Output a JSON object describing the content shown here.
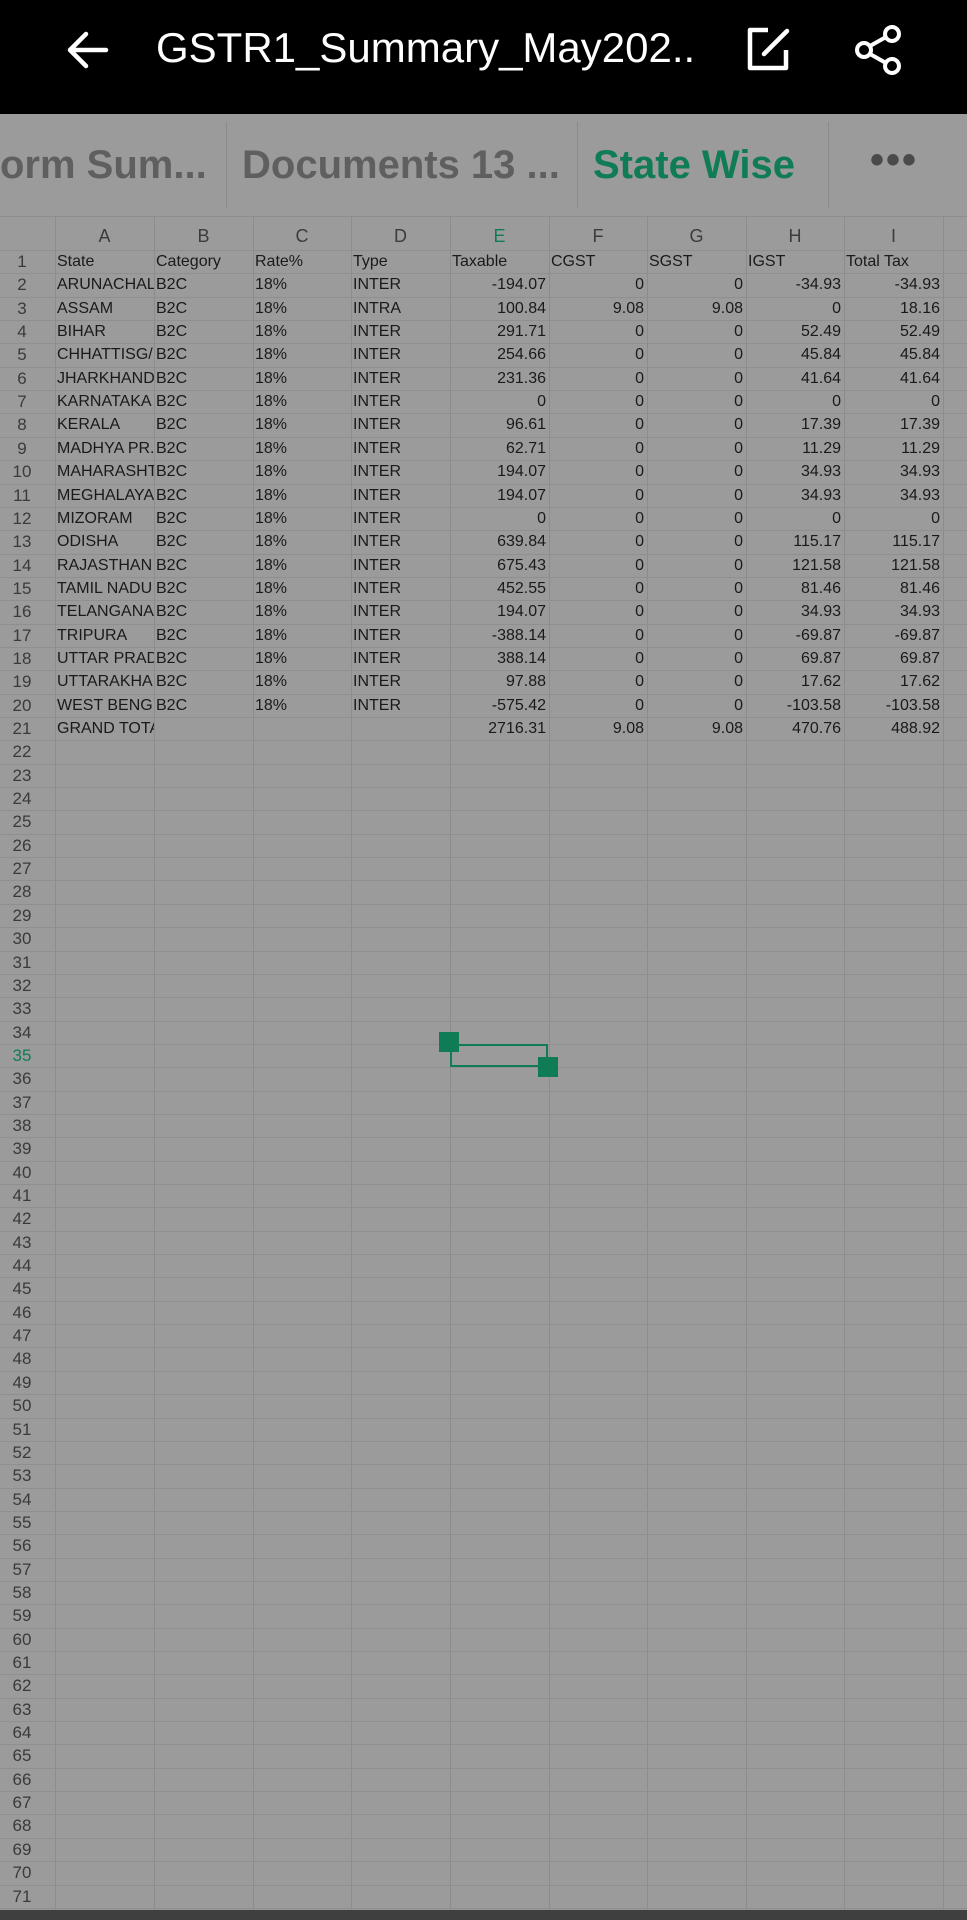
{
  "header": {
    "title": "GSTR1_Summary_May202...",
    "back_icon": "arrow-left-icon",
    "edit_icon": "edit-icon",
    "share_icon": "share-icon"
  },
  "tabs": [
    {
      "label": "orm Sum..."
    },
    {
      "label": "Documents 13 ..."
    },
    {
      "label": "State Wise",
      "active": true
    },
    {
      "label": "•••"
    }
  ],
  "sheet": {
    "columns": [
      "A",
      "B",
      "C",
      "D",
      "E",
      "F",
      "G",
      "H",
      "I"
    ],
    "active_column": "E",
    "active_row": 35,
    "header_row": [
      "State",
      "Category",
      "Rate%",
      "Type",
      "Taxable",
      "CGST",
      "SGST",
      "IGST",
      "Total Tax"
    ],
    "rows": [
      [
        "ARUNACHAL",
        "B2C",
        "18%",
        "INTER",
        "-194.07",
        "0",
        "0",
        "-34.93",
        "-34.93"
      ],
      [
        "ASSAM",
        "B2C",
        "18%",
        "INTRA",
        "100.84",
        "9.08",
        "9.08",
        "0",
        "18.16"
      ],
      [
        "BIHAR",
        "B2C",
        "18%",
        "INTER",
        "291.71",
        "0",
        "0",
        "52.49",
        "52.49"
      ],
      [
        "CHHATTISG/",
        "B2C",
        "18%",
        "INTER",
        "254.66",
        "0",
        "0",
        "45.84",
        "45.84"
      ],
      [
        "JHARKHAND",
        "B2C",
        "18%",
        "INTER",
        "231.36",
        "0",
        "0",
        "41.64",
        "41.64"
      ],
      [
        "KARNATAKA",
        "B2C",
        "18%",
        "INTER",
        "0",
        "0",
        "0",
        "0",
        "0"
      ],
      [
        "KERALA",
        "B2C",
        "18%",
        "INTER",
        "96.61",
        "0",
        "0",
        "17.39",
        "17.39"
      ],
      [
        "MADHYA PR.",
        "B2C",
        "18%",
        "INTER",
        "62.71",
        "0",
        "0",
        "11.29",
        "11.29"
      ],
      [
        "MAHARASHT",
        "B2C",
        "18%",
        "INTER",
        "194.07",
        "0",
        "0",
        "34.93",
        "34.93"
      ],
      [
        "MEGHALAYA",
        "B2C",
        "18%",
        "INTER",
        "194.07",
        "0",
        "0",
        "34.93",
        "34.93"
      ],
      [
        "MIZORAM",
        "B2C",
        "18%",
        "INTER",
        "0",
        "0",
        "0",
        "0",
        "0"
      ],
      [
        "ODISHA",
        "B2C",
        "18%",
        "INTER",
        "639.84",
        "0",
        "0",
        "115.17",
        "115.17"
      ],
      [
        "RAJASTHAN",
        "B2C",
        "18%",
        "INTER",
        "675.43",
        "0",
        "0",
        "121.58",
        "121.58"
      ],
      [
        "TAMIL NADU",
        "B2C",
        "18%",
        "INTER",
        "452.55",
        "0",
        "0",
        "81.46",
        "81.46"
      ],
      [
        "TELANGANA",
        "B2C",
        "18%",
        "INTER",
        "194.07",
        "0",
        "0",
        "34.93",
        "34.93"
      ],
      [
        "TRIPURA",
        "B2C",
        "18%",
        "INTER",
        "-388.14",
        "0",
        "0",
        "-69.87",
        "-69.87"
      ],
      [
        "UTTAR PRAD",
        "B2C",
        "18%",
        "INTER",
        "388.14",
        "0",
        "0",
        "69.87",
        "69.87"
      ],
      [
        "UTTARAKHA",
        "B2C",
        "18%",
        "INTER",
        "97.88",
        "0",
        "0",
        "17.62",
        "17.62"
      ],
      [
        "WEST BENG.",
        "B2C",
        "18%",
        "INTER",
        "-575.42",
        "0",
        "0",
        "-103.58",
        "-103.58"
      ],
      [
        "GRAND TOTA",
        "",
        "",
        "",
        "2716.31",
        "9.08",
        "9.08",
        "470.76",
        "488.92"
      ]
    ],
    "row_count": 71
  }
}
